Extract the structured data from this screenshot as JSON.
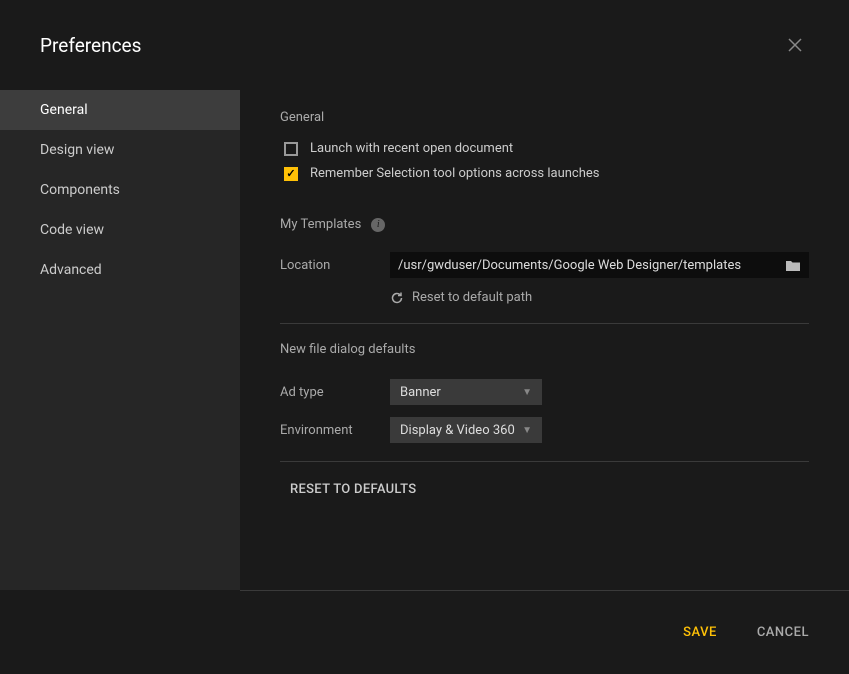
{
  "header": {
    "title": "Preferences"
  },
  "sidebar": {
    "items": [
      {
        "label": "General",
        "active": true
      },
      {
        "label": "Design view",
        "active": false
      },
      {
        "label": "Components",
        "active": false
      },
      {
        "label": "Code view",
        "active": false
      },
      {
        "label": "Advanced",
        "active": false
      }
    ]
  },
  "general": {
    "section_title": "General",
    "launch_recent": {
      "label": "Launch with recent open document",
      "checked": false
    },
    "remember_selection": {
      "label": "Remember Selection tool options across launches",
      "checked": true
    }
  },
  "my_templates": {
    "title": "My Templates",
    "location_label": "Location",
    "location_path": "/usr/gwduser/Documents/Google Web Designer/templates",
    "reset_link": "Reset to default path"
  },
  "new_file_defaults": {
    "title": "New file dialog defaults",
    "ad_type": {
      "label": "Ad type",
      "value": "Banner"
    },
    "environment": {
      "label": "Environment",
      "value": "Display & Video 360"
    }
  },
  "actions": {
    "reset_defaults": "RESET TO DEFAULTS",
    "save": "SAVE",
    "cancel": "CANCEL"
  }
}
